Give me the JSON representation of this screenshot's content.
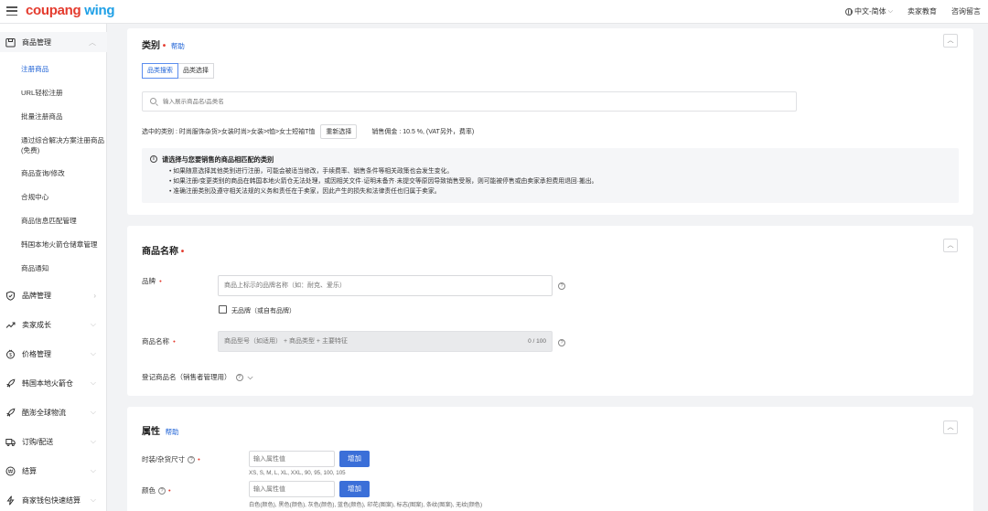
{
  "app": {
    "logo_brand": "coupang",
    "logo_wing": "wing"
  },
  "topbar": {
    "language": "中文-简体",
    "seller_education": "卖家教育",
    "consult": "咨询留言"
  },
  "sidebar": {
    "product_management": "商品管理",
    "items": [
      "注册商品",
      "URL轻松注册",
      "批量注册商品",
      "通过综合解决方案注册商品 (免费)",
      "商品查询/修改",
      "合规中心",
      "商品信息匹配管理",
      "韩国本地火箭仓储章管理",
      "商品通知"
    ],
    "groups": [
      "品牌管理",
      "卖家成长",
      "价格管理",
      "韩国本地火箭仓",
      "酷澎全球物流",
      "订购/配送",
      "结算",
      "商家钱包快速结算"
    ]
  },
  "category": {
    "title": "类别",
    "help": "帮助",
    "tabs": [
      "品类搜索",
      "品类选择"
    ],
    "search_placeholder": "输入展示商品名/品类名",
    "selected_label": "选中的类别 : 时尚服饰杂货>女装时尚>女装>t恤>女士短袖T恤",
    "reselect": "重新选择",
    "commission": "销售佣金 : 10.5 %, (VAT另外，费率)",
    "notice_title": "请选择与您要销售的商品相匹配的类别",
    "notice_items": [
      "如果随意选择其他类别进行注册，可能会被适当修改，手续费率、销售条件等相关政策也会发生变化。",
      "如果注册/变更类别的商品在韩国本地火箭仓无法处理，或因相关文件·证明未备齐·未提交等原因导致销售受限，则可能被停售或由卖家承担费用退回·搬出。",
      "准确注册类别及遵守相关法规的义务和责任在于卖家，因此产生的损失和法律责任也归属于卖家。"
    ]
  },
  "product_name": {
    "title": "商品名称",
    "brand_label": "品牌",
    "brand_placeholder": "商品上标示的品牌名称（如：耐克、爱乐）",
    "no_brand": "无品牌（或自有品牌）",
    "name_label": "商品名称",
    "name_placeholder": "商品型号（如适用） + 商品类型 + 主要特征",
    "counter": "0 / 100",
    "register_name": "登记商品名（销售者管理用）"
  },
  "attributes": {
    "title": "属性",
    "help": "帮助",
    "size_label": "时装/杂货尺寸",
    "size_placeholder": "输入属性值",
    "add": "增加",
    "size_hint": "XS, S, M, L, XL, XXL, 90, 95, 100, 105",
    "color_label": "颜色",
    "color_placeholder": "输入属性值",
    "color_hint": "白色(颜色), 黑色(颜色), 灰色(颜色), 蓝色(颜色), 印花(图案), 标志(图案), 条纹(图案), 无纹(颜色)"
  },
  "colors": {
    "accent": "#1e62d6",
    "required": "#e43b2e",
    "button": "#3b6fd8",
    "background": "#f2f3f5"
  },
  "icons": [
    "menu-icon",
    "globe-icon",
    "chevron-down-icon",
    "chevron-up-icon",
    "chevron-right-icon",
    "search-icon",
    "info-icon",
    "question-icon",
    "checkbox-icon"
  ]
}
